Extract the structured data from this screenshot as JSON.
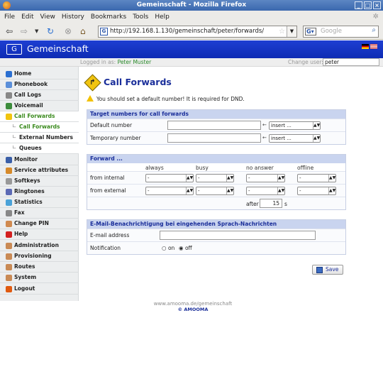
{
  "window": {
    "title": "Gemeinschaft - Mozilla Firefox"
  },
  "menu": [
    "File",
    "Edit",
    "View",
    "History",
    "Bookmarks",
    "Tools",
    "Help"
  ],
  "browser": {
    "url": "http://192.168.1.130/gemeinschaft/peter/forwards/",
    "search_placeholder": "Google"
  },
  "app": {
    "name": "Gemeinschaft"
  },
  "userbar": {
    "logged_in_label": "Logged in as:",
    "user": "Peter Muster",
    "change_user_label": "Change user:",
    "change_user_value": "peter"
  },
  "sidebar": [
    {
      "label": "Home",
      "icon": "globe-icon",
      "color": "#2a6fd1"
    },
    {
      "label": "Phonebook",
      "icon": "phonebook-icon",
      "color": "#5b8fd9"
    },
    {
      "label": "Call Logs",
      "icon": "clock-icon",
      "color": "#888888"
    },
    {
      "label": "Voicemail",
      "icon": "voicemail-icon",
      "color": "#3c8c3c"
    },
    {
      "label": "Call Forwards",
      "icon": "forward-icon",
      "color": "#f1c40f",
      "active": true
    },
    {
      "label": "Call Forwards",
      "sub": true,
      "selected": true
    },
    {
      "label": "External Numbers",
      "sub": true
    },
    {
      "label": "Queues",
      "sub": true
    },
    {
      "label": "Monitor",
      "icon": "monitor-icon",
      "color": "#3a5fa8"
    },
    {
      "label": "Service attributes",
      "icon": "wrench-icon",
      "color": "#d68a2a"
    },
    {
      "label": "Softkeys",
      "icon": "keys-icon",
      "color": "#999999"
    },
    {
      "label": "Ringtones",
      "icon": "music-icon",
      "color": "#5c6ab5"
    },
    {
      "label": "Statistics",
      "icon": "stats-icon",
      "color": "#4aa2d8"
    },
    {
      "label": "Fax",
      "icon": "fax-icon",
      "color": "#888888"
    },
    {
      "label": "Change PIN",
      "icon": "pin-icon",
      "color": "#d08a50"
    },
    {
      "label": "Help",
      "icon": "help-icon",
      "color": "#d32020"
    },
    {
      "label": "Administration",
      "icon": "admin-icon",
      "color": "#c98a55"
    },
    {
      "label": "Provisioning",
      "icon": "provisioning-icon",
      "color": "#c98a55"
    },
    {
      "label": "Routes",
      "icon": "routes-icon",
      "color": "#c98a55"
    },
    {
      "label": "System",
      "icon": "system-icon",
      "color": "#c98a55"
    },
    {
      "label": "Logout",
      "icon": "logout-icon",
      "color": "#e05a10"
    }
  ],
  "page": {
    "title": "Call Forwards",
    "warning": "You should set a default number! It is required for DND."
  },
  "targets": {
    "header": "Target numbers for call forwards",
    "rows": [
      {
        "label": "Default number",
        "value": "",
        "select": "insert ..."
      },
      {
        "label": "Temporary number",
        "value": "",
        "select": "insert ..."
      }
    ]
  },
  "forward": {
    "header": "Forward ...",
    "columns": [
      "always",
      "busy",
      "no answer",
      "offline"
    ],
    "rows": [
      {
        "label": "from internal",
        "values": [
          "-",
          "-",
          "-",
          "-"
        ]
      },
      {
        "label": "from external",
        "values": [
          "-",
          "-",
          "-",
          "-"
        ]
      }
    ],
    "after_label": "after",
    "after_value": "15",
    "after_unit": "s"
  },
  "email": {
    "header": "E-Mail-Benachrichtigung bei eingehenden Sprach-Nachrichten",
    "address_label": "E-mail address",
    "address_value": "",
    "notification_label": "Notification",
    "options": [
      "on",
      "off"
    ],
    "selected": "off"
  },
  "save_label": "Save",
  "footer": {
    "link": "www.amooma.de/gemeinschaft",
    "copyright": "© AMOOMA"
  }
}
